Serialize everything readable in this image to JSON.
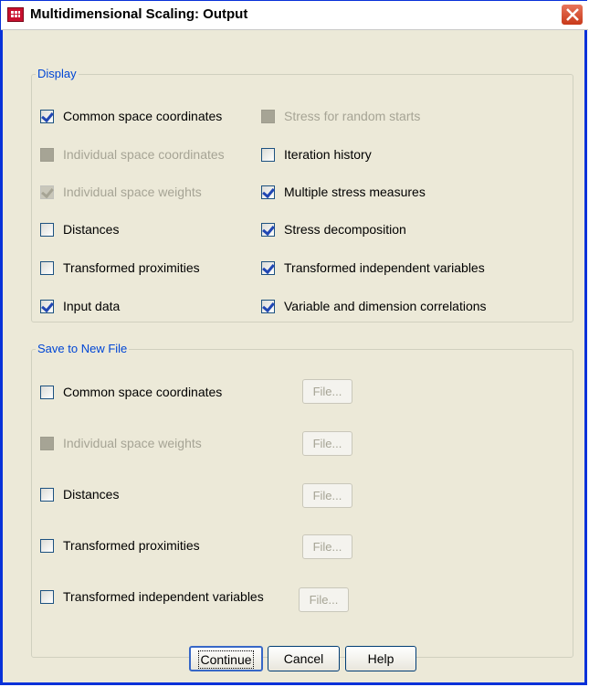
{
  "window": {
    "title": "Multidimensional Scaling: Output",
    "accent": "#0831d9"
  },
  "display": {
    "title": "Display",
    "left": [
      {
        "label": "Common space coordinates",
        "checked": true,
        "enabled": true
      },
      {
        "label": "Individual space coordinates",
        "checked": false,
        "enabled": false
      },
      {
        "label": "Individual space weights",
        "checked": true,
        "enabled": false
      },
      {
        "label": "Distances",
        "checked": false,
        "enabled": true
      },
      {
        "label": "Transformed proximities",
        "checked": false,
        "enabled": true
      },
      {
        "label": "Input data",
        "checked": true,
        "enabled": true
      }
    ],
    "right": [
      {
        "label": "Stress for random starts",
        "checked": false,
        "enabled": false
      },
      {
        "label": "Iteration history",
        "checked": false,
        "enabled": true
      },
      {
        "label": "Multiple stress measures",
        "checked": true,
        "enabled": true
      },
      {
        "label": "Stress decomposition",
        "checked": true,
        "enabled": true
      },
      {
        "label": "Transformed independent variables",
        "checked": true,
        "enabled": true
      },
      {
        "label": "Variable and dimension correlations",
        "checked": true,
        "enabled": true
      }
    ]
  },
  "save": {
    "title": "Save to New File",
    "items": [
      {
        "label": "Common space coordinates",
        "checked": false,
        "enabled": true,
        "file_label": "File..."
      },
      {
        "label": "Individual space weights",
        "checked": false,
        "enabled": false,
        "file_label": "File..."
      },
      {
        "label": "Distances",
        "checked": false,
        "enabled": true,
        "file_label": "File..."
      },
      {
        "label": "Transformed proximities",
        "checked": false,
        "enabled": true,
        "file_label": "File..."
      },
      {
        "label": "Transformed independent variables",
        "checked": false,
        "enabled": true,
        "file_label": "File..."
      }
    ]
  },
  "buttons": {
    "continue": "Continue",
    "cancel": "Cancel",
    "help": "Help"
  }
}
